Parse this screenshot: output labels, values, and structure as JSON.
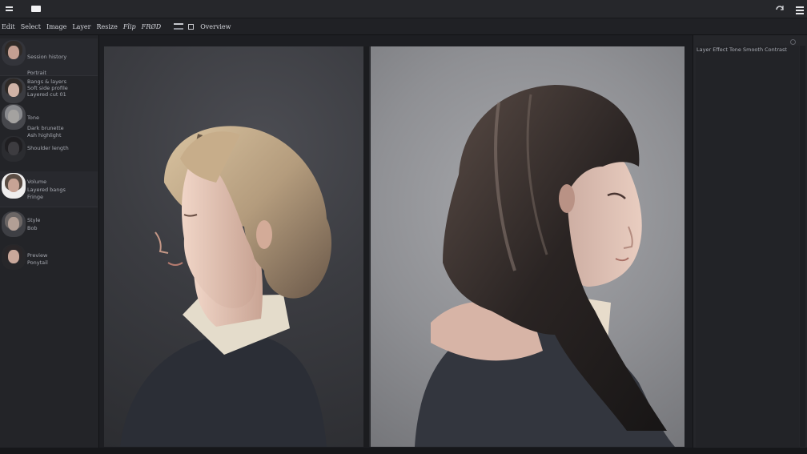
{
  "titlebar": {
    "menu_icon": "hamburger-icon",
    "window_icon": "window-icon",
    "refresh_icon": "refresh-icon",
    "right_menu_icon": "menu-icon"
  },
  "toolbar": {
    "menu": [
      "Edit",
      "Select",
      "Image",
      "Layer",
      "Resize",
      "Flip",
      "FRØD"
    ],
    "options_label": "Overview"
  },
  "sidebar": {
    "items": [
      {
        "lines": [
          "Session history",
          "Portrait"
        ],
        "face": "#c49f92",
        "hair": "#2f2a27"
      },
      {
        "lines": [
          "Bangs & layers",
          "Soft side profile",
          "Layered cut 01"
        ],
        "face": "#d0b3a6",
        "hair": "#2f2a27"
      },
      {
        "lines": [
          "Tone",
          "Dark brunette",
          "Ash highlight",
          "Shoulder length"
        ],
        "face": "#a4a2a0",
        "hair": "#898a8e"
      },
      {
        "lines": [
          "Volume",
          "Layered bangs",
          "Fringe"
        ],
        "face": "#c7a395",
        "hair": "#5b4d44"
      },
      {
        "lines": [
          "Style",
          "Bob"
        ],
        "face": "#b29f95",
        "hair": "#6b6665"
      },
      {
        "lines": [
          "Preview",
          "Ponytail"
        ],
        "face": "#c9a89b",
        "hair": "#2a2628"
      }
    ]
  },
  "panel": {
    "title": "Layer Effect Tone Smooth Contrast"
  },
  "colors": {
    "background": "#1e1f23",
    "panel": "#25262a",
    "canvas_left": "#3b3c41",
    "canvas_right": "#8f9094",
    "accent_text": "#d2d4da"
  }
}
